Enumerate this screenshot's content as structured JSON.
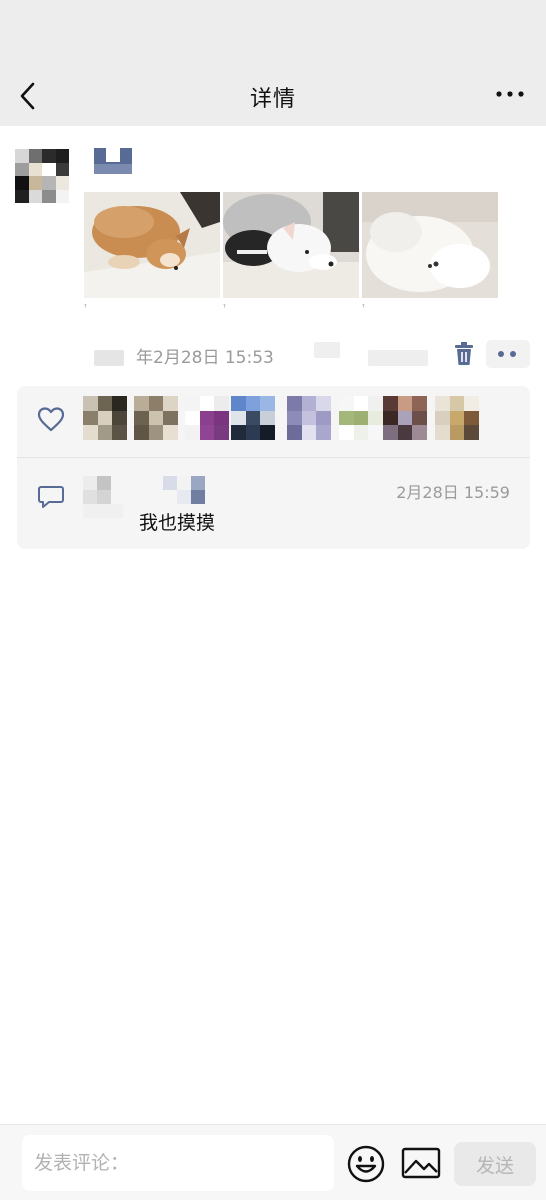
{
  "nav": {
    "title": "详情"
  },
  "post": {
    "photos": [
      {
        "subject": "shiba-dog-lying"
      },
      {
        "subject": "white-dog-in-jacket"
      },
      {
        "subject": "white-fluffy-dog"
      }
    ],
    "photo_captions": [
      "?",
      "?",
      "?"
    ],
    "time": "年2月28日 15:53"
  },
  "likes": {
    "icon": "heart-icon",
    "count_shown": 8
  },
  "comments": [
    {
      "time": "2月28日 15:59",
      "text": "我也摸摸"
    }
  ],
  "input_bar": {
    "placeholder": "发表评论：",
    "send_label": "发送"
  },
  "colors": {
    "background": "#ffffff",
    "nav_background": "#ededed",
    "link_blue": "#576b95",
    "muted_text": "#9a9a9a",
    "panel_background": "#f5f5f5"
  }
}
